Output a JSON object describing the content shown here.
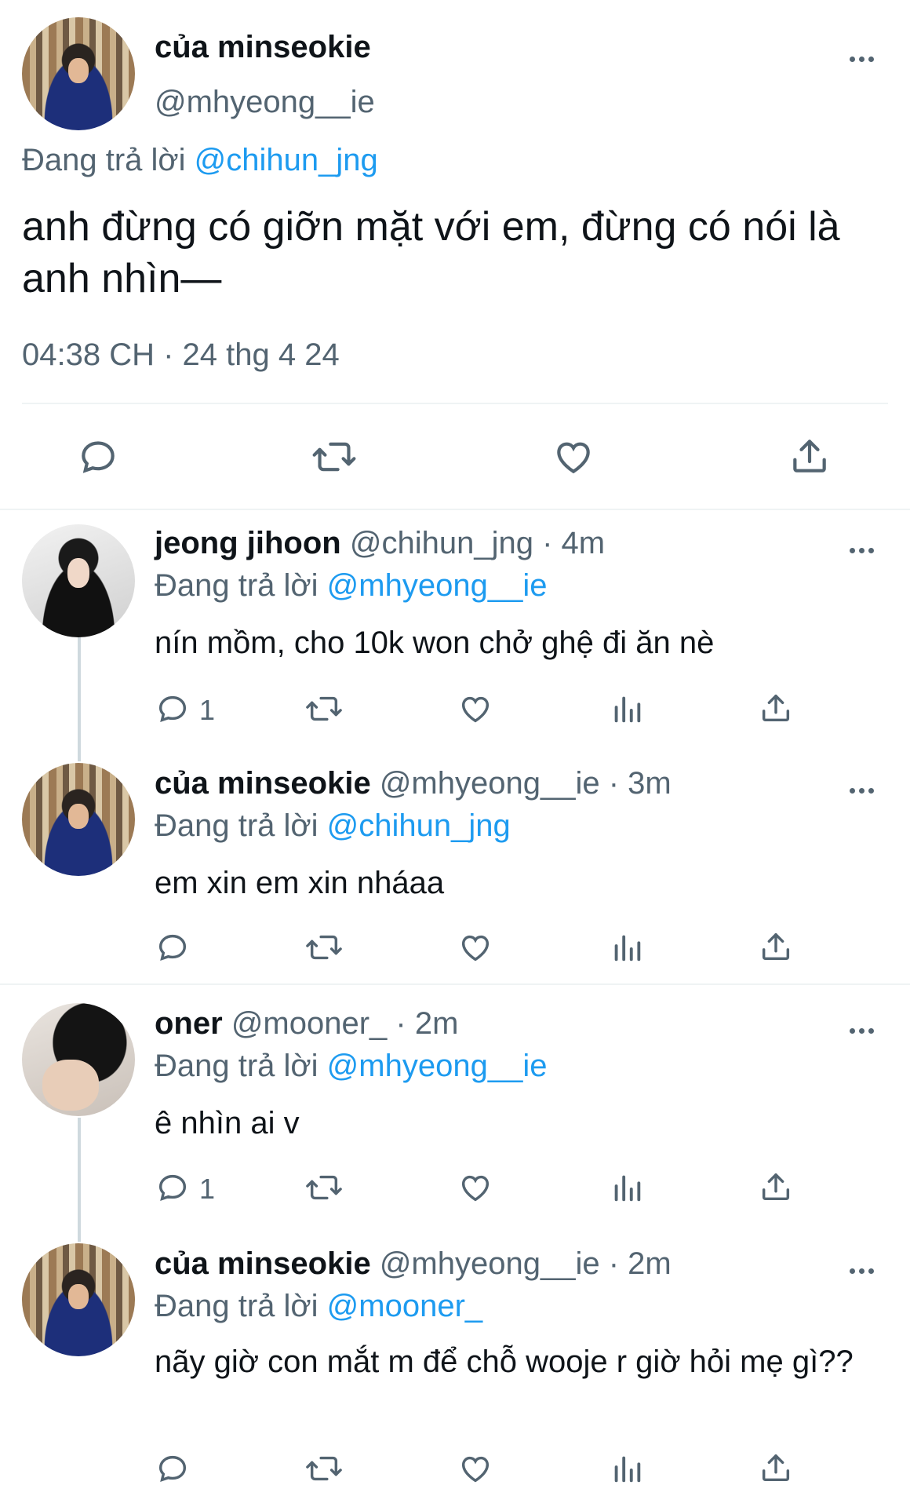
{
  "main_tweet": {
    "display_name": "của minseokie",
    "handle": "@mhyeong__ie",
    "replying_prefix": "Đang trả lời",
    "replying_to": "@chihun_jng",
    "text": "anh đừng có giỡn mặt với em, đừng có nói là anh nhìn—",
    "timestamp": "04:38 CH · 24 thg 4 24"
  },
  "replies": [
    {
      "display_name": "jeong jihoon",
      "handle_time": "@chihun_jng · 4m",
      "replying_prefix": "Đang trả lời",
      "replying_to": "@mhyeong__ie",
      "text": "nín mồm, cho 10k won chở ghệ đi ăn nè",
      "reply_count": "1"
    },
    {
      "display_name": "của minseokie",
      "handle_time": "@mhyeong__ie · 3m",
      "replying_prefix": "Đang trả lời",
      "replying_to": "@chihun_jng",
      "text": "em xin em xin nháaa",
      "reply_count": ""
    },
    {
      "display_name": "oner",
      "handle_time": "@mooner_ · 2m",
      "replying_prefix": "Đang trả lời",
      "replying_to": "@mhyeong__ie",
      "text": "ê nhìn ai v",
      "reply_count": "1"
    },
    {
      "display_name": "của minseokie",
      "handle_time": "@mhyeong__ie · 2m",
      "replying_prefix": "Đang trả lời",
      "replying_to": "@mooner_",
      "text": "nãy giờ con mắt m để chỗ wooje r giờ hỏi mẹ gì??",
      "reply_count": ""
    }
  ],
  "colors": {
    "link": "#1d9bf0",
    "secondary_text": "#536471",
    "divider": "#eff3f4",
    "thread_line": "#cfd9de"
  },
  "icons": [
    "reply-icon",
    "retweet-icon",
    "like-icon",
    "views-icon",
    "share-icon",
    "more-icon"
  ]
}
